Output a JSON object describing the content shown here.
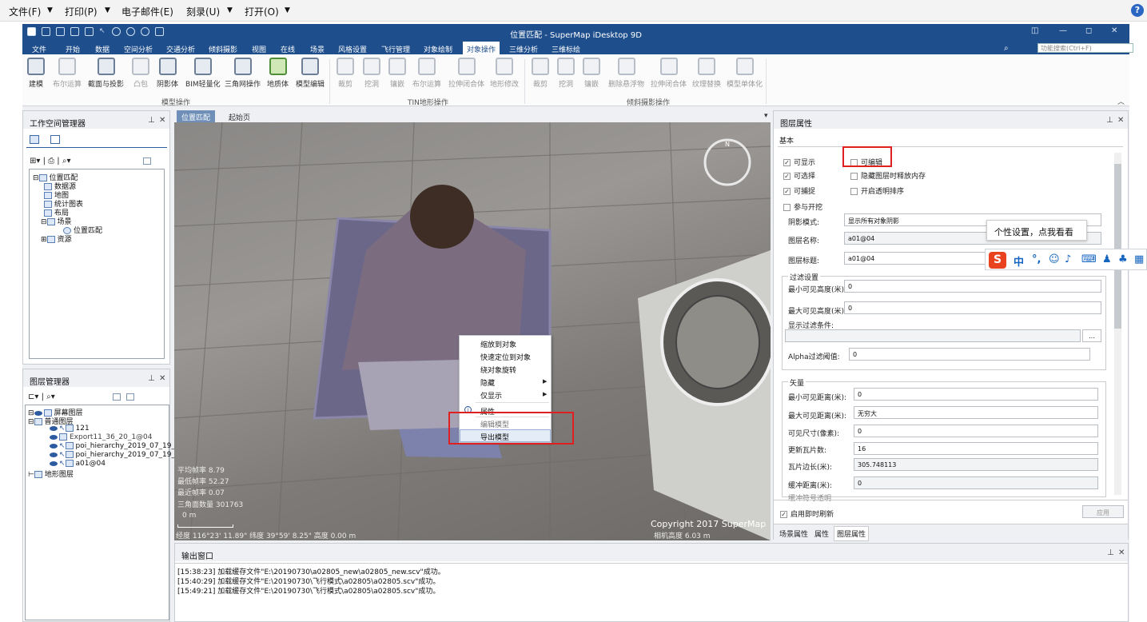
{
  "topmenu": {
    "file": "文件(F)",
    "print": "打印(P)",
    "email": "电子邮件(E)",
    "burn": "刻录(U)",
    "open": "打开(O)"
  },
  "app": {
    "title": "位置匹配 - SuperMap iDesktop 9D",
    "search_placeholder": "功能搜索(Ctrl+F)"
  },
  "ribbon_tabs": [
    "文件",
    "开始",
    "数据",
    "空间分析",
    "交通分析",
    "倾斜摄影",
    "视图",
    "在线",
    "场景",
    "风格设置",
    "飞行管理",
    "对象绘制",
    "对象操作",
    "三维分析",
    "三维标绘"
  ],
  "ribbon_active": "对象操作",
  "ribbon": {
    "model_group": {
      "label": "模型操作",
      "buttons": [
        "建模",
        "布尔运算",
        "截面与投影",
        "凸包",
        "阴影体",
        "BIM轻量化",
        "三角网操作",
        "地质体",
        "模型编辑"
      ]
    },
    "tin_group": {
      "label": "TIN地形操作",
      "buttons": [
        "裁剪",
        "挖洞",
        "镶嵌",
        "布尔运算",
        "拉伸闭合体",
        "地形修改"
      ]
    },
    "oblique_group": {
      "label": "倾斜摄影操作",
      "buttons": [
        "裁剪",
        "挖洞",
        "镶嵌",
        "删除悬浮物",
        "拉伸闭合体",
        "纹理替换",
        "模型单体化"
      ]
    }
  },
  "workspace": {
    "title": "工作空间管理器",
    "tree": [
      "位置匹配",
      "数据源",
      "地图",
      "统计图表",
      "布局",
      "场景",
      "位置匹配",
      "资源"
    ]
  },
  "layers": {
    "title": "图层管理器",
    "tree": [
      "屏幕图层",
      "普通图层",
      "121",
      "Export11_36_20_1@04",
      "poi_hierarchy_2019_07_19_1_10",
      "poi_hierarchy_2019_07_19_1_10",
      "a01@04",
      "地形图层"
    ]
  },
  "viewtabs": [
    "位置匹配",
    "起始页"
  ],
  "scene": {
    "stats": [
      "平均帧率 8.79",
      "最低帧率 52.27",
      "最近帧率 0.07",
      "三角面数量 301763",
      "0 m"
    ],
    "coords": "经度 116°23' 11.89\"  纬度 39°59' 8.25\"  高度 0.00 m",
    "copyright": "Copyright 2017 SuperMap",
    "camera": "相机高度 6.03 m"
  },
  "context_menu": [
    "缩放到对象",
    "快速定位到对象",
    "绕对象旋转",
    "隐藏",
    "仅显示",
    "属性",
    "编辑模型",
    "导出模型"
  ],
  "props": {
    "title": "图层属性",
    "section_basic": "基本",
    "visible": "可显示",
    "editable": "可编辑",
    "selectable": "可选择",
    "release_mem": "隐藏图层时释放内存",
    "snappable": "可捕捉",
    "transparency_sort": "开启透明排序",
    "clipping": "参与开挖",
    "shadow_label": "阴影模式:",
    "shadow_value": "显示所有对象阴影",
    "name_label": "图层名称:",
    "name_value": "a01@04",
    "caption_label": "图层标题:",
    "caption_value": "a01@04",
    "filter_group": "过滤设置",
    "min_height_label": "最小可见高度(米):",
    "min_height_value": "0",
    "max_height_label": "最大可见高度(米):",
    "max_height_value": "0",
    "filter_cond_label": "显示过滤条件:",
    "alpha_label": "Alpha过滤阈值:",
    "alpha_value": "0",
    "vector_group": "矢量",
    "min_dist_label": "最小可见距离(米):",
    "min_dist_value": "0",
    "max_dist_label": "最大可见距离(米):",
    "max_dist_value": "无穷大",
    "min_size_label": "可见尺寸(像素):",
    "min_size_value": "0",
    "update_tiles_label": "更新瓦片数:",
    "update_tiles_value": "16",
    "tile_len_label": "瓦片边长(米):",
    "tile_len_value": "305.748113",
    "buffer_label": "缓冲距离(米):",
    "buffer_value": "0",
    "cut_label": "缓冲符号透明",
    "realtime": "启用即时刷新",
    "apply": "应用",
    "bottom_tabs": [
      "场景属性",
      "属性",
      "图层属性"
    ]
  },
  "output": {
    "title": "输出窗口",
    "lines": [
      "[15:38:23] 加载缓存文件\"E:\\20190730\\a02805_new\\a02805_new.scv\"成功。",
      "[15:40:29] 加载缓存文件\"E:\\20190730\\飞行模式\\a02805\\a02805.scv\"成功。",
      "[15:49:21] 加载缓存文件\"E:\\20190730\\飞行模式\\a02805\\a02805.scv\"成功。"
    ]
  },
  "tooltip": "个性设置，点我看看",
  "ime": {
    "lang": "中"
  },
  "colors": {
    "title_bar": "#1e4e8c",
    "highlight": "#e02020"
  }
}
